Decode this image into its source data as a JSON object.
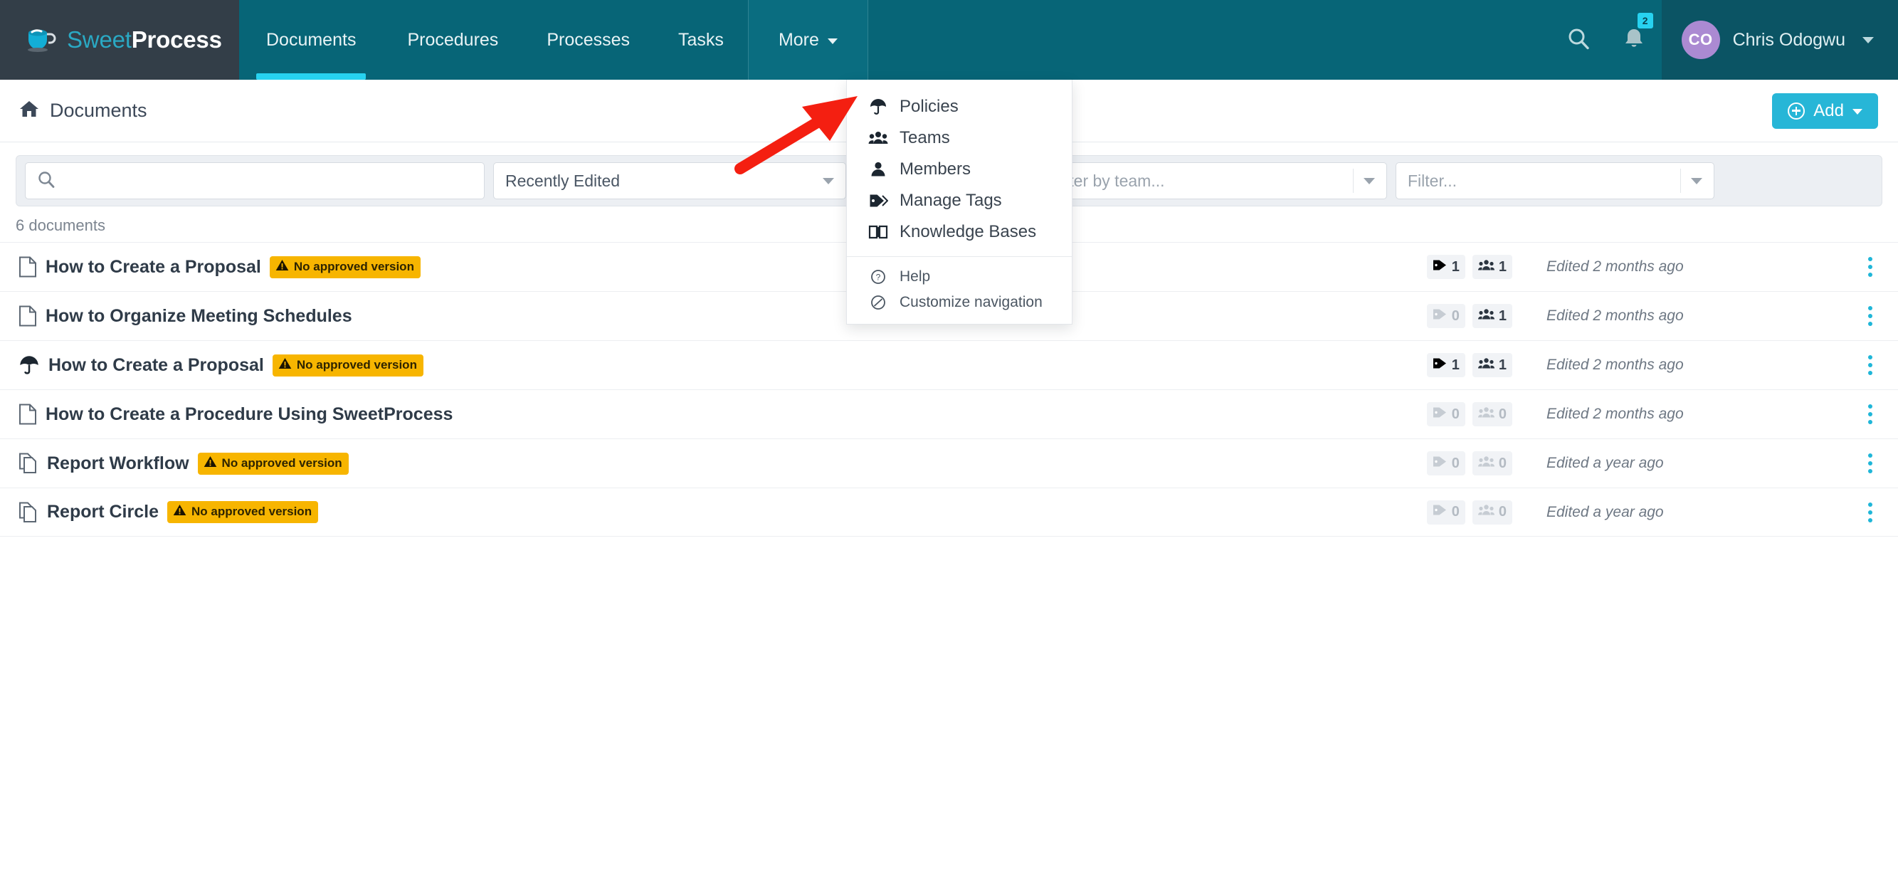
{
  "brand": {
    "name_light": "Sweet",
    "name_bold": "Process",
    "logo_icon": "coffee-cup-icon"
  },
  "topnav": {
    "tabs": [
      {
        "label": "Documents",
        "active": true
      },
      {
        "label": "Procedures",
        "active": false
      },
      {
        "label": "Processes",
        "active": false
      },
      {
        "label": "Tasks",
        "active": false
      }
    ],
    "more_label": "More",
    "search_icon": "search-icon",
    "bell_icon": "bell-icon",
    "notification_count": "2",
    "user": {
      "initials": "CO",
      "name": "Chris Odogwu"
    }
  },
  "more_menu": {
    "items": [
      {
        "label": "Policies",
        "icon": "umbrella-icon"
      },
      {
        "label": "Teams",
        "icon": "users-group-icon"
      },
      {
        "label": "Members",
        "icon": "user-icon"
      },
      {
        "label": "Manage Tags",
        "icon": "tag-icon"
      },
      {
        "label": "Knowledge Bases",
        "icon": "book-open-icon"
      }
    ],
    "footer_items": [
      {
        "label": "Help",
        "icon": "question-circle-icon"
      },
      {
        "label": "Customize navigation",
        "icon": "slash-circle-icon"
      }
    ]
  },
  "subheader": {
    "breadcrumb_icon": "home-icon",
    "breadcrumb_label": "Documents",
    "add_label": "Add",
    "add_icon": "plus-circle-icon"
  },
  "filterbar": {
    "search_placeholder": "",
    "search_value": "",
    "search_icon": "search-icon",
    "sort_value": "Recently Edited",
    "hidden_filter_value": "",
    "team_placeholder": "Filter by team...",
    "last_placeholder": "Filter..."
  },
  "list": {
    "count_label": "6 documents",
    "warning_label": "No approved version",
    "warning_icon": "warning-triangle-icon",
    "tag_icon": "tag-icon",
    "team_icon": "users-group-icon",
    "kebab_icon": "kebab-menu-icon",
    "rows": [
      {
        "icon": "document-icon",
        "title": "How to Create a Proposal",
        "warning": true,
        "tags": "1",
        "teams": "1",
        "edited": "Edited 2 months ago"
      },
      {
        "icon": "document-icon",
        "title": "How to Organize Meeting Schedules",
        "warning": false,
        "tags": "0",
        "teams": "1",
        "edited": "Edited 2 months ago"
      },
      {
        "icon": "umbrella-icon",
        "title": "How to Create a Proposal",
        "warning": true,
        "tags": "1",
        "teams": "1",
        "edited": "Edited 2 months ago"
      },
      {
        "icon": "document-icon",
        "title": "How to Create a Procedure Using SweetProcess",
        "warning": false,
        "tags": "0",
        "teams": "0",
        "edited": "Edited 2 months ago"
      },
      {
        "icon": "process-copy-icon",
        "title": "Report Workflow",
        "warning": true,
        "tags": "0",
        "teams": "0",
        "edited": "Edited a year ago"
      },
      {
        "icon": "process-copy-icon",
        "title": "Report Circle",
        "warning": true,
        "tags": "0",
        "teams": "0",
        "edited": "Edited a year ago"
      }
    ]
  },
  "annotation": {
    "type": "red-arrow",
    "points_to": "Policies",
    "color": "#f41f11"
  },
  "colors": {
    "nav_teal": "#076577",
    "brand_dark": "#333e48",
    "accent_cyan": "#27d2f0",
    "add_button": "#27b6d7",
    "warning_yellow": "#f7b500",
    "avatar_purple": "#ab8ad2"
  }
}
